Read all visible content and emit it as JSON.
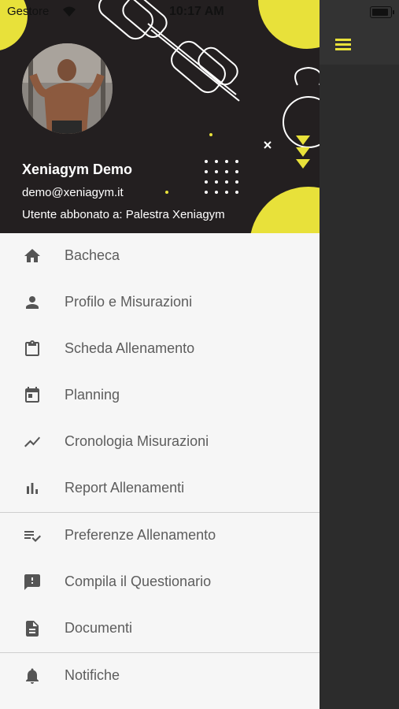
{
  "status_bar": {
    "carrier": "Gestore",
    "time": "10:17 AM"
  },
  "profile": {
    "name": "Xeniagym Demo",
    "email": "demo@xeniagym.it",
    "subscription": "Utente abbonato a: Palestra Xeniagym"
  },
  "menu_group_1": [
    {
      "label": "Bacheca",
      "icon": "home-icon"
    },
    {
      "label": "Profilo e Misurazioni",
      "icon": "person-icon"
    },
    {
      "label": "Scheda Allenamento",
      "icon": "clipboard-icon"
    },
    {
      "label": "Planning",
      "icon": "calendar-icon"
    },
    {
      "label": "Cronologia Misurazioni",
      "icon": "trending-line-icon"
    },
    {
      "label": "Report Allenamenti",
      "icon": "bar-chart-icon"
    }
  ],
  "menu_group_2": [
    {
      "label": "Preferenze Allenamento",
      "icon": "checklist-icon"
    },
    {
      "label": "Compila il Questionario",
      "icon": "feedback-icon"
    },
    {
      "label": "Documenti",
      "icon": "document-icon"
    }
  ],
  "menu_group_3": [
    {
      "label": "Notifiche",
      "icon": "bell-icon"
    }
  ],
  "colors": {
    "accent": "#e8e13a",
    "header_bg": "#231f20",
    "drawer_bg": "#f6f6f6",
    "text": "#5d5d5d",
    "icon": "#555555"
  }
}
